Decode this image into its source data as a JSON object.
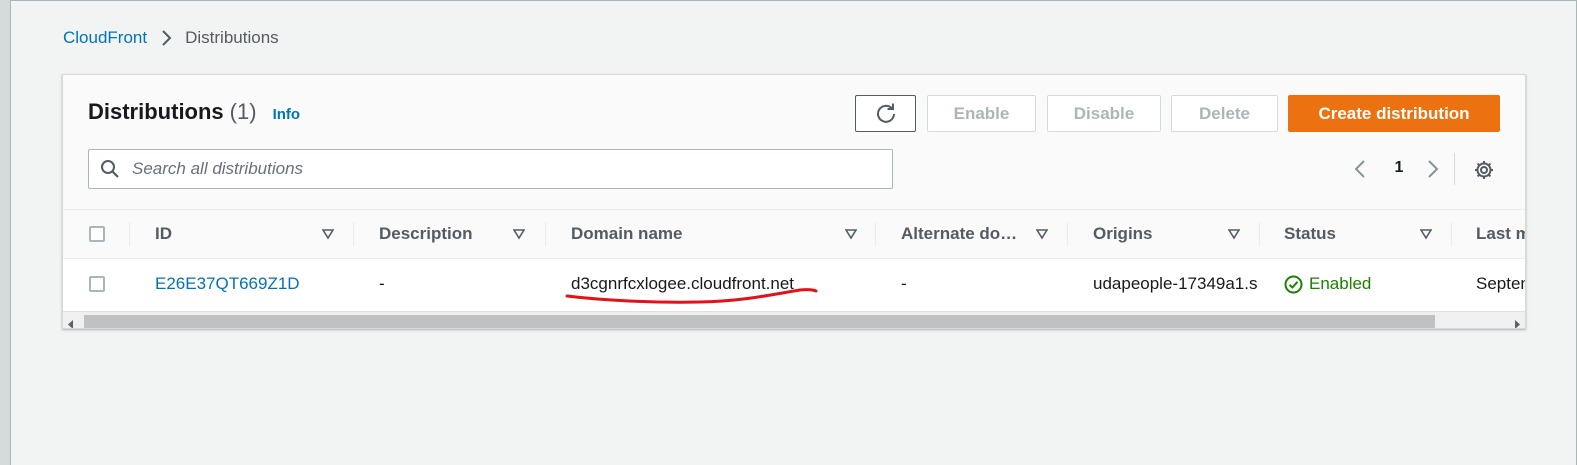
{
  "breadcrumb": {
    "service": "CloudFront",
    "current": "Distributions"
  },
  "header": {
    "title": "Distributions",
    "count": "(1)",
    "info": "Info"
  },
  "actions": {
    "enable": "Enable",
    "disable": "Disable",
    "delete": "Delete",
    "create": "Create distribution"
  },
  "search": {
    "placeholder": "Search all distributions",
    "value": ""
  },
  "pagination": {
    "current_page": "1"
  },
  "table": {
    "columns": [
      "ID",
      "Description",
      "Domain name",
      "Alternate do…",
      "Origins",
      "Status",
      "Last m"
    ],
    "rows": [
      {
        "id": "E26E37QT669Z1D",
        "description": "-",
        "domain_name": "d3cgnrfcxlogee.cloudfront.net",
        "alternate_domain": "-",
        "origins": "udapeople-17349a1.s",
        "status": "Enabled",
        "last_modified": "Septen"
      }
    ]
  },
  "colors": {
    "accent_orange": "#ec7211",
    "link_blue": "#0073bb",
    "status_green": "#1d8102",
    "annotation_red": "#e0121a"
  },
  "icons": [
    "chevron-right-icon",
    "refresh-icon",
    "search-icon",
    "chevron-left-icon",
    "settings-gear-icon",
    "sort-down-icon",
    "check-circle-icon",
    "scroll-left-icon",
    "scroll-right-icon"
  ]
}
